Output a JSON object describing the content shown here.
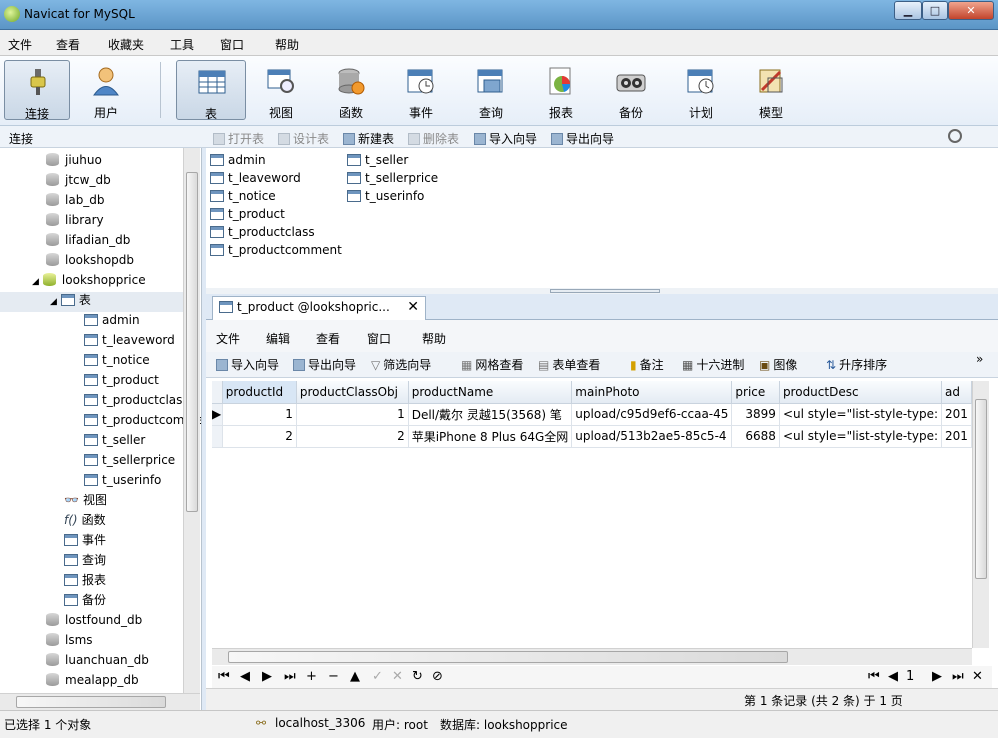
{
  "title": "Navicat for MySQL",
  "window_buttons": {
    "minimize": "▁",
    "maximize": "□",
    "close": "✕"
  },
  "menu": [
    "文件",
    "查看",
    "收藏夹",
    "工具",
    "窗口",
    "帮助"
  ],
  "toolbar": [
    "连接",
    "用户",
    "表",
    "视图",
    "函数",
    "事件",
    "查询",
    "报表",
    "备份",
    "计划",
    "模型"
  ],
  "subbar": {
    "left_label": "连接",
    "actions": [
      "打开表",
      "设计表",
      "新建表",
      "删除表",
      "导入向导",
      "导出向导"
    ]
  },
  "tree": {
    "databases_top": [
      "jiuhuo",
      "jtcw_db",
      "lab_db",
      "library",
      "lifadian_db",
      "lookshopdb"
    ],
    "open_db": "lookshopprice",
    "table_group": "表",
    "tables": [
      "admin",
      "t_leaveword",
      "t_notice",
      "t_product",
      "t_productclass",
      "t_productcomment",
      "t_seller",
      "t_sellerprice",
      "t_userinfo"
    ],
    "other_groups": [
      "视图",
      "函数",
      "事件",
      "查询",
      "报表",
      "备份"
    ],
    "databases_bottom": [
      "lostfound_db",
      "lsms",
      "luanchuan_db",
      "mealapp_db"
    ]
  },
  "table_list": [
    "admin",
    "t_leaveword",
    "t_notice",
    "t_product",
    "t_productclass",
    "t_productcomment",
    "t_seller",
    "t_sellerprice",
    "t_userinfo"
  ],
  "tab": {
    "label": "t_product @lookshopric...",
    "close": "✕"
  },
  "inner_menu": [
    "文件",
    "编辑",
    "查看",
    "窗口",
    "帮助"
  ],
  "inner_tools": [
    "导入向导",
    "导出向导",
    "筛选向导",
    "网格查看",
    "表单查看",
    "备注",
    "十六进制",
    "图像",
    "升序排序"
  ],
  "grid": {
    "columns": [
      "productId",
      "productClassObj",
      "productName",
      "mainPhoto",
      "price",
      "productDesc",
      "ad"
    ],
    "rows": [
      [
        "1",
        "1",
        "Dell/戴尔 灵越15(3568) 笔",
        "upload/c95d9ef6-ccaa-45",
        "3899",
        "<ul style=\"list-style-type:",
        "201"
      ],
      [
        "2",
        "2",
        "苹果iPhone 8 Plus 64G全网",
        "upload/513b2ae5-85c5-4",
        "6688",
        "<ul style=\"list-style-type:",
        "201"
      ]
    ]
  },
  "nav_buttons": [
    "⏮",
    "◀",
    "▶",
    "⏭",
    "+",
    "−",
    "▲",
    "✓",
    "✕",
    "↻",
    "⊘"
  ],
  "page_num": "1",
  "record_info": "第 1 条记录 (共 2 条) 于 1 页",
  "status": {
    "selected": "已选择 1 个对象",
    "connection": "localhost_3306",
    "user": "用户: root",
    "database": "数据库: lookshopprice"
  }
}
